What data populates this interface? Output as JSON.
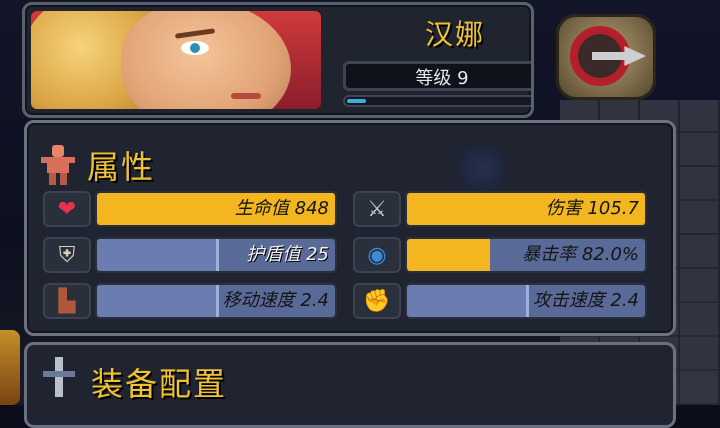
{
  "hero": {
    "name": "汉娜",
    "level_label": "等级 9",
    "xp_fraction": 0.1
  },
  "stats_panel": {
    "title": "属性"
  },
  "stats": [
    {
      "id": "hp",
      "label": "生命值 848",
      "icon": "heart-icon",
      "fill": 1.0,
      "fill_color": "#f3b61f",
      "text_light": false
    },
    {
      "id": "damage",
      "label": "伤害 105.7",
      "icon": "sword-icon",
      "fill": 1.0,
      "fill_color": "#f3b61f",
      "text_light": false
    },
    {
      "id": "shield",
      "label": "护盾值 25",
      "icon": "shield-icon",
      "fill": 0.5,
      "fill_color": "#5a6a98",
      "text_light": true
    },
    {
      "id": "crit",
      "label": "暴击率 82.0%",
      "icon": "eye-icon",
      "fill": 0.35,
      "fill_color": "#f3b61f",
      "text_light": false
    },
    {
      "id": "move",
      "label": "移动速度 2.4",
      "icon": "boot-icon",
      "fill": 0.5,
      "fill_color": "#5a6a98",
      "text_light": false
    },
    {
      "id": "attack_speed",
      "label": "攻击速度 2.4",
      "icon": "fist-icon",
      "fill": 0.5,
      "fill_color": "#5a6a98",
      "text_light": false
    }
  ],
  "equip_panel": {
    "title": "装备配置"
  },
  "colors": {
    "accent": "#f0c232",
    "bar_gold": "#f3b61f",
    "bar_blue": "#5a6a98"
  }
}
